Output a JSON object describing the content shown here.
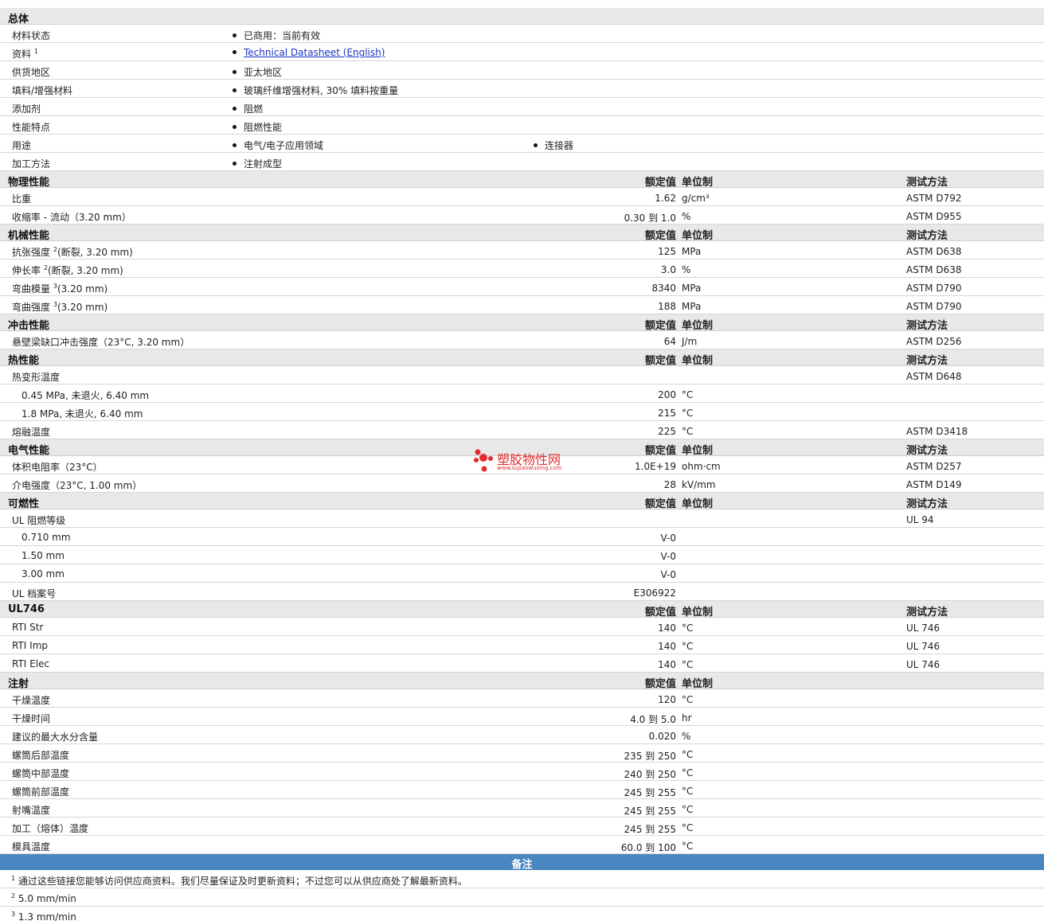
{
  "headers": {
    "value": "额定值",
    "unit": "单位制",
    "test": "测试方法"
  },
  "general": {
    "title": "总体",
    "rows": [
      {
        "label": "材料状态",
        "items": [
          "已商用：当前有效"
        ]
      },
      {
        "label": "资料",
        "sup": "1",
        "link": "Technical Datasheet (English)"
      },
      {
        "label": "供货地区",
        "items": [
          "亚太地区"
        ]
      },
      {
        "label": "填料/增强材料",
        "items": [
          "玻璃纤维增强材料, 30% 填料按重量"
        ]
      },
      {
        "label": "添加剂",
        "items": [
          "阻燃"
        ]
      },
      {
        "label": "性能特点",
        "items": [
          "阻燃性能"
        ]
      },
      {
        "label": "用途",
        "items": [
          "电气/电子应用领域",
          "连接器"
        ]
      },
      {
        "label": "加工方法",
        "items": [
          "注射成型"
        ]
      }
    ]
  },
  "sections": [
    {
      "title": "物理性能",
      "showTest": true,
      "rows": [
        {
          "label": "比重",
          "value": "1.62",
          "unit": "g/cm³",
          "test": "ASTM D792"
        },
        {
          "label": "收缩率 - 流动（3.20 mm）",
          "value": "0.30 到  1.0",
          "unit": "%",
          "test": "ASTM D955"
        }
      ]
    },
    {
      "title": "机械性能",
      "showTest": true,
      "rows": [
        {
          "label": "抗张强度",
          "sup": "2",
          "after": "(断裂, 3.20 mm)",
          "value": "125",
          "unit": "MPa",
          "test": "ASTM D638"
        },
        {
          "label": "伸长率",
          "sup": "2",
          "after": "(断裂, 3.20 mm)",
          "value": "3.0",
          "unit": "%",
          "test": "ASTM D638"
        },
        {
          "label": "弯曲模量",
          "sup": "3",
          "after": "(3.20 mm)",
          "value": "8340",
          "unit": "MPa",
          "test": "ASTM D790"
        },
        {
          "label": "弯曲强度",
          "sup": "3",
          "after": "(3.20 mm)",
          "value": "188",
          "unit": "MPa",
          "test": "ASTM D790"
        }
      ]
    },
    {
      "title": "冲击性能",
      "showTest": true,
      "rows": [
        {
          "label": "悬壁梁缺口冲击强度（23°C, 3.20 mm）",
          "value": "64",
          "unit": "J/m",
          "test": "ASTM D256"
        }
      ]
    },
    {
      "title": "热性能",
      "showTest": true,
      "rows": [
        {
          "label": "热变形温度",
          "value": "",
          "unit": "",
          "test": "ASTM D648"
        },
        {
          "label": "0.45 MPa, 未退火, 6.40 mm",
          "sub": true,
          "value": "200",
          "unit": "°C",
          "test": ""
        },
        {
          "label": "1.8 MPa, 未退火, 6.40 mm",
          "sub": true,
          "value": "215",
          "unit": "°C",
          "test": ""
        },
        {
          "label": "熔融温度",
          "value": "225",
          "unit": "°C",
          "test": "ASTM D3418"
        }
      ]
    },
    {
      "title": "电气性能",
      "showTest": true,
      "rows": [
        {
          "label": "体积电阻率（23°C）",
          "value": "1.0E+19",
          "unit": "ohm·cm",
          "test": "ASTM D257"
        },
        {
          "label": "介电强度（23°C, 1.00 mm）",
          "value": "28",
          "unit": "kV/mm",
          "test": "ASTM D149"
        }
      ]
    },
    {
      "title": "可燃性",
      "showTest": true,
      "rows": [
        {
          "label": "UL 阻燃等级",
          "value": "",
          "unit": "",
          "test": "UL 94"
        },
        {
          "label": "0.710 mm",
          "sub": true,
          "value": "V-0",
          "unit": "",
          "test": ""
        },
        {
          "label": "1.50 mm",
          "sub": true,
          "value": "V-0",
          "unit": "",
          "test": ""
        },
        {
          "label": "3.00 mm",
          "sub": true,
          "value": "V-0",
          "unit": "",
          "test": ""
        },
        {
          "label": "UL 档案号",
          "value": "E306922",
          "unit": "",
          "test": ""
        }
      ]
    },
    {
      "title": "UL746",
      "showTest": true,
      "rows": [
        {
          "label": "RTI Str",
          "value": "140",
          "unit": "°C",
          "test": "UL 746"
        },
        {
          "label": "RTI Imp",
          "value": "140",
          "unit": "°C",
          "test": "UL 746"
        },
        {
          "label": "RTI Elec",
          "value": "140",
          "unit": "°C",
          "test": "UL 746"
        }
      ]
    },
    {
      "title": "注射",
      "showTest": false,
      "rows": [
        {
          "label": "干燥温度",
          "value": "120",
          "unit": "°C",
          "test": ""
        },
        {
          "label": "干燥时间",
          "value": "4.0 到  5.0",
          "unit": "hr",
          "test": ""
        },
        {
          "label": "建议的最大水分含量",
          "value": "0.020",
          "unit": "%",
          "test": ""
        },
        {
          "label": "螺筒后部温度",
          "value": "235 到  250",
          "unit": "°C",
          "test": ""
        },
        {
          "label": "螺筒中部温度",
          "value": "240 到  250",
          "unit": "°C",
          "test": ""
        },
        {
          "label": "螺筒前部温度",
          "value": "245 到  255",
          "unit": "°C",
          "test": ""
        },
        {
          "label": "射嘴温度",
          "value": "245 到  255",
          "unit": "°C",
          "test": ""
        },
        {
          "label": "加工（熔体）温度",
          "value": "245 到  255",
          "unit": "°C",
          "test": ""
        },
        {
          "label": "模具温度",
          "value": "60.0 到  100",
          "unit": "°C",
          "test": ""
        }
      ]
    }
  ],
  "remarks": {
    "title": "备注",
    "notes": [
      {
        "sup": "1",
        "text": "通过这些链接您能够访问供应商资料。我们尽量保证及时更新资料；不过您可以从供应商处了解最新资料。"
      },
      {
        "sup": "2",
        "text": "5.0 mm/min"
      },
      {
        "sup": "3",
        "text": "1.3 mm/min"
      }
    ]
  },
  "watermark": {
    "text": "塑胶物性网",
    "url": "www.sujiaowuxing.com",
    "color": "#e22d2d"
  }
}
